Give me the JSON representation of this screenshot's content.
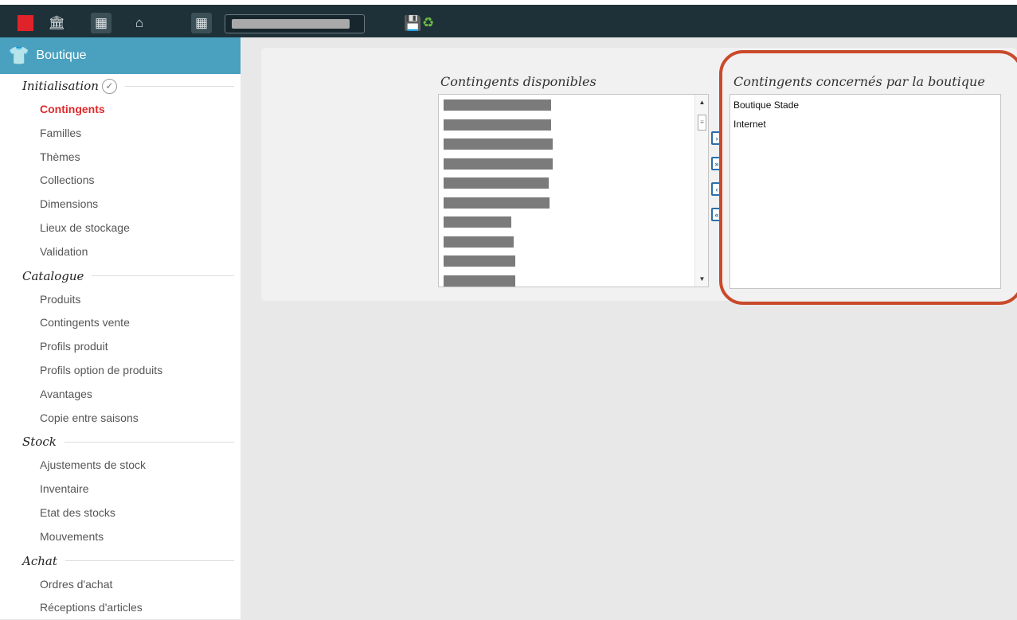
{
  "toolbar": {
    "icons": [
      "bank-icon",
      "building-icon",
      "home-icon",
      "building-icon",
      "save-icon",
      "refresh-icon"
    ]
  },
  "sidebar": {
    "header": "Boutique",
    "sections": [
      {
        "title": "Initialisation",
        "items": [
          "Contingents",
          "Familles",
          "Thèmes",
          "Collections",
          "Dimensions",
          "Lieux de stockage",
          "Validation"
        ]
      },
      {
        "title": "Catalogue",
        "items": [
          "Produits",
          "Contingents vente",
          "Profils produit",
          "Profils option de produits",
          "Avantages",
          "Copie entre saisons"
        ]
      },
      {
        "title": "Stock",
        "items": [
          "Ajustements de stock",
          "Inventaire",
          "Etat des stocks",
          "Mouvements"
        ]
      },
      {
        "title": "Achat",
        "items": [
          "Ordres d'achat",
          "Réceptions d'articles"
        ]
      }
    ],
    "active_item": "Contingents"
  },
  "main": {
    "available_title": "Contingents disponibles",
    "assigned_title": "Contingents concernés par la boutique",
    "assigned_items": [
      "Boutique Stade",
      "Internet"
    ]
  }
}
